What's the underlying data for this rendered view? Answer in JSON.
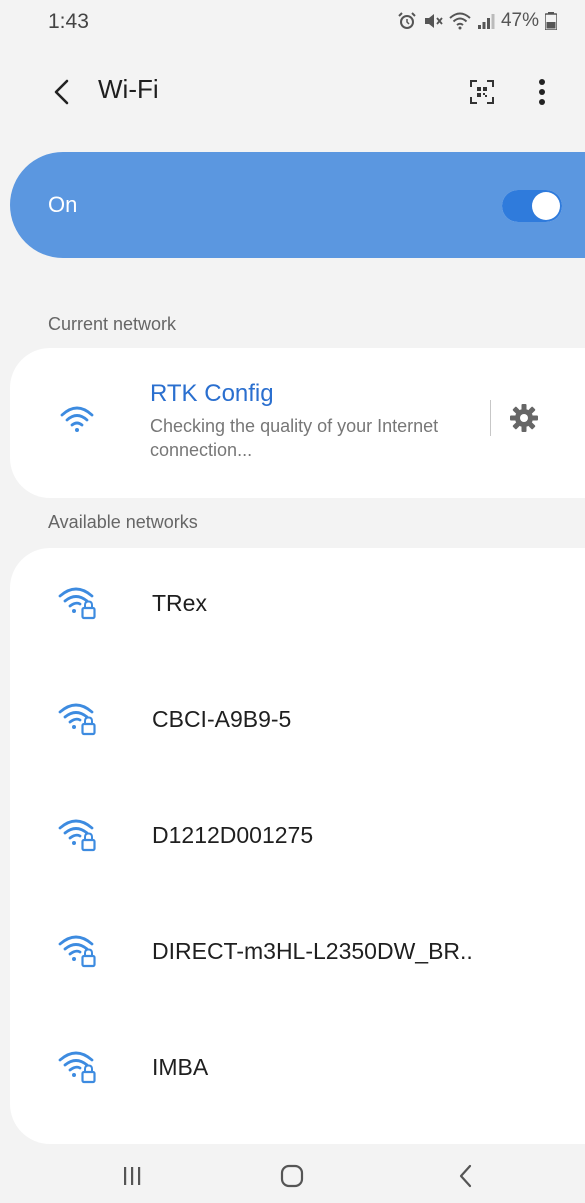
{
  "status_bar": {
    "time": "1:43",
    "battery": "47%",
    "icons": [
      "alarm-icon",
      "mute-icon",
      "wifi-icon",
      "signal-icon",
      "battery-icon"
    ]
  },
  "app_bar": {
    "title": "Wi-Fi",
    "back_icon": "back-chevron-icon",
    "qr_icon": "qr-scan-icon",
    "more_icon": "more-vertical-icon"
  },
  "wifi_toggle": {
    "label": "On",
    "state": true,
    "accent_color": "#5b97e0"
  },
  "current_network": {
    "section_label": "Current network",
    "name": "RTK Config",
    "status": "Checking the quality of your Internet connection...",
    "icon": "wifi-icon",
    "settings_icon": "gear-icon"
  },
  "available_networks": {
    "section_label": "Available networks",
    "items": [
      {
        "name": "TRex",
        "icon": "wifi-locked-icon"
      },
      {
        "name": "CBCI-A9B9-5",
        "icon": "wifi-locked-icon"
      },
      {
        "name": "D1212D001275",
        "icon": "wifi-locked-icon"
      },
      {
        "name": "DIRECT-m3HL-L2350DW_BR..",
        "icon": "wifi-locked-icon"
      },
      {
        "name": "IMBA",
        "icon": "wifi-locked-icon"
      }
    ]
  },
  "nav_bar": {
    "recents_icon": "recents-icon",
    "home_icon": "home-icon",
    "back_icon": "back-icon"
  },
  "colors": {
    "accent": "#2a6fcf",
    "wifi_icon": "#3d8be0",
    "background": "#f3f3f3"
  }
}
